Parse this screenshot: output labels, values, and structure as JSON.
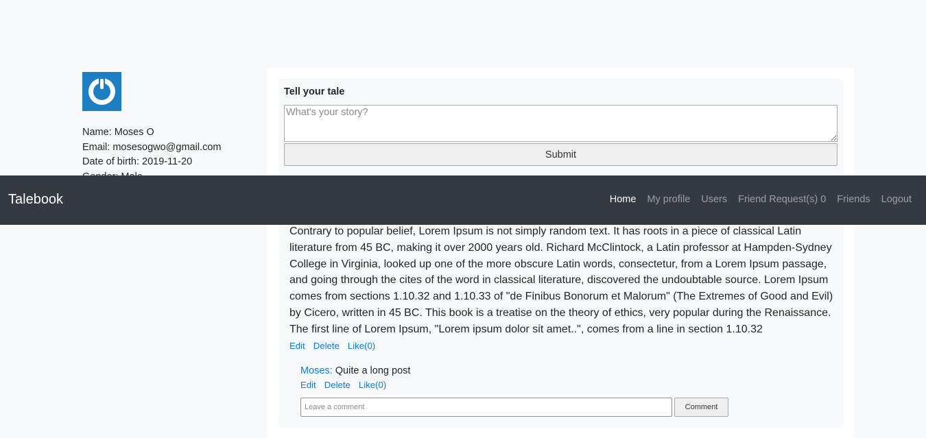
{
  "profile": {
    "avatar_icon": "power-icon",
    "name_line": "Name: Moses O",
    "email_line": "Email: mosesogwo@gmail.com",
    "dob_line": "Date of birth: 2019-11-20",
    "gender_line": "Gender: Male"
  },
  "compose": {
    "title": "Tell your tale",
    "placeholder": "What's your story?",
    "submit_label": "Submit"
  },
  "post": {
    "text": "Contrary to popular belief, Lorem Ipsum is not simply random text. It has roots in a piece of classical Latin literature from 45 BC, making it over 2000 years old. Richard McClintock, a Latin professor at Hampden-Sydney College in Virginia, looked up one of the more obscure Latin words, consectetur, from a Lorem Ipsum passage, and going through the cites of the word in classical literature, discovered the undoubtable source. Lorem Ipsum comes from sections 1.10.32 and 1.10.33 of \"de Finibus Bonorum et Malorum\" (The Extremes of Good and Evil) by Cicero, written in 45 BC. This book is a treatise on the theory of ethics, very popular during the Renaissance. The first line of Lorem Ipsum, \"Lorem ipsum dolor sit amet..\", comes from a line in section 1.10.32",
    "edit_label": "Edit",
    "delete_label": "Delete",
    "like_label": "Like(0)"
  },
  "comment": {
    "author": "Moses:",
    "text": "Quite a long post",
    "edit_label": "Edit",
    "delete_label": "Delete",
    "like_label": "Like(0)",
    "input_placeholder": "Leave a comment",
    "button_label": "Comment"
  },
  "navbar": {
    "brand": "Talebook",
    "items": [
      {
        "label": "Home",
        "active": true
      },
      {
        "label": "My profile"
      },
      {
        "label": "Users"
      },
      {
        "label": "Friend Request(s) 0"
      },
      {
        "label": "Friends"
      },
      {
        "label": "Logout"
      }
    ]
  },
  "colors": {
    "navbar_bg": "#343a40",
    "link": "#007bff",
    "avatar_bg": "#1c7fc4"
  }
}
